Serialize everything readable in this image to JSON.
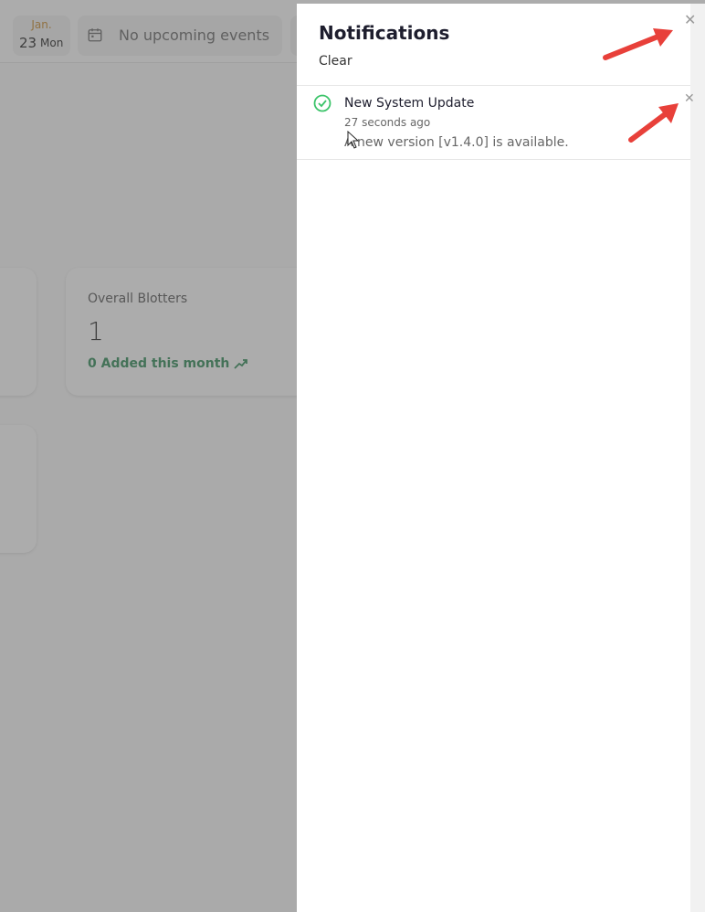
{
  "topbar": {
    "date": {
      "month": "Jan.",
      "day": "23",
      "weekday": "Mon"
    },
    "events": {
      "icon": "calendar-icon",
      "text": "No upcoming events"
    }
  },
  "dashboard": {
    "card": {
      "title": "Overall Blotters",
      "value": "1",
      "subtitle": "0 Added this month",
      "trend_icon": "trending-up-icon"
    }
  },
  "notifications": {
    "title": "Notifications",
    "clear_label": "Clear",
    "close_icon": "close-icon",
    "items": [
      {
        "icon": "check-circle-icon",
        "title": "New System Update",
        "time": "27 seconds ago",
        "message": "A new version [v1.4.0] is available."
      }
    ]
  },
  "colors": {
    "accent_green": "#2e8b57",
    "check_green": "#3cc46a",
    "annotation_red": "#e8403a",
    "month_orange": "#c98a2b"
  }
}
